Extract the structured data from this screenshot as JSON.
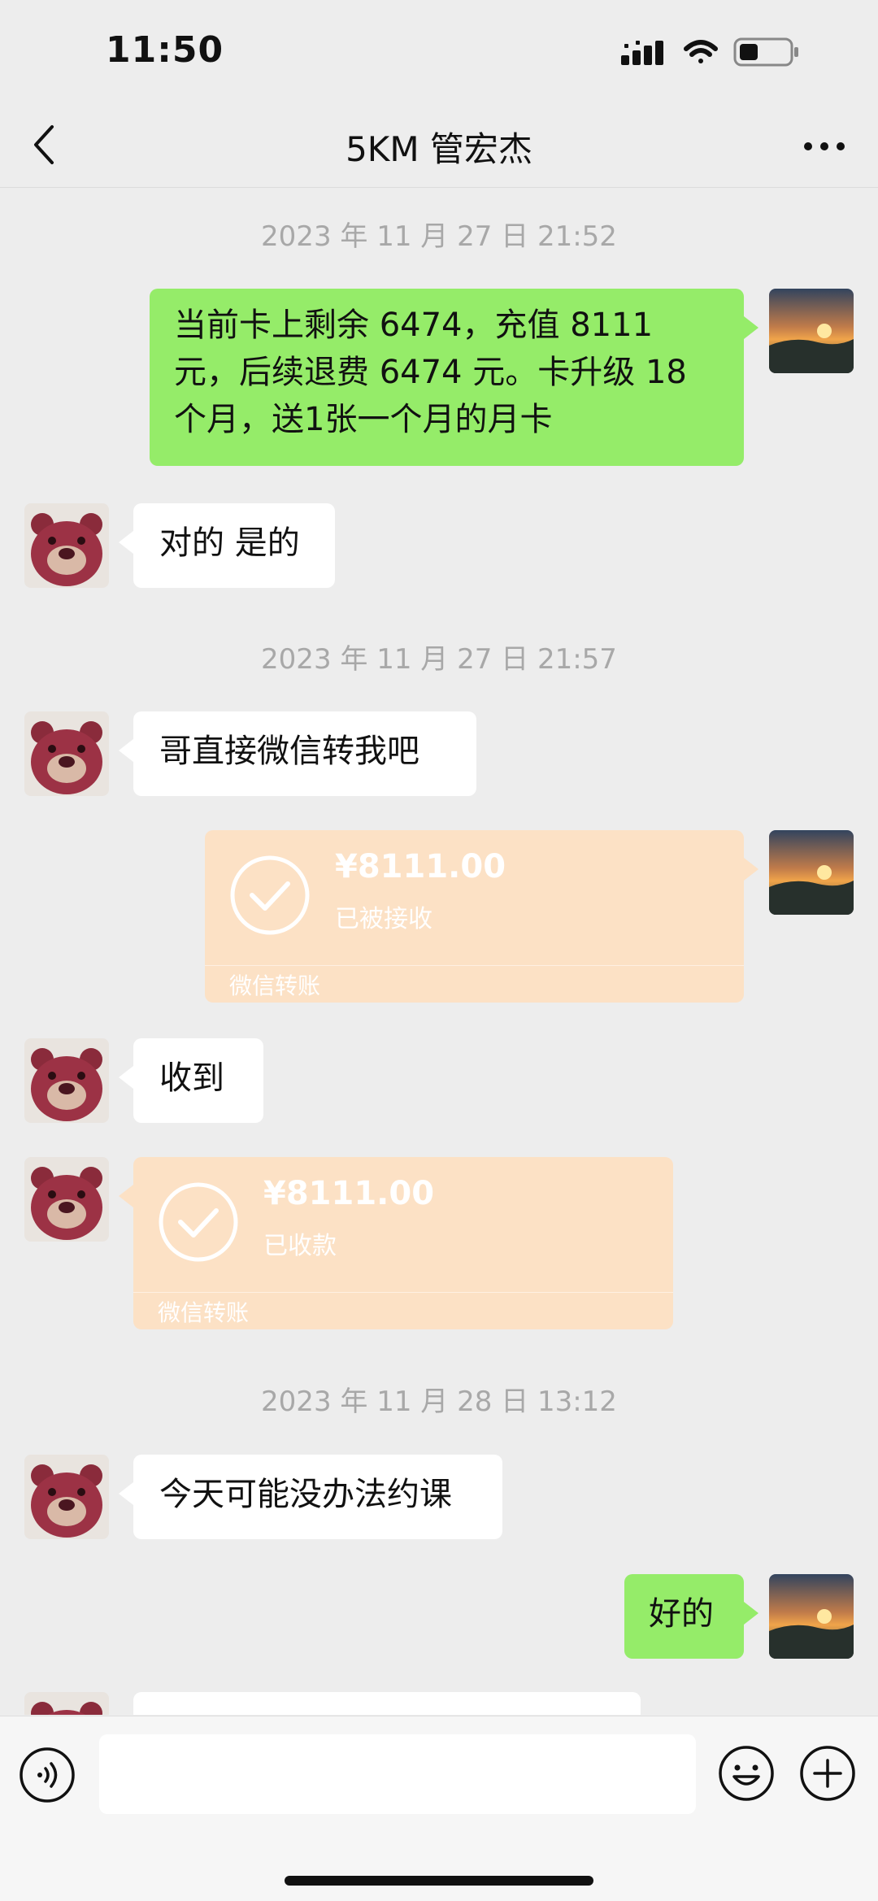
{
  "status_bar": {
    "time": "11:50"
  },
  "header": {
    "back_icon": "chevron-left-icon",
    "title": "5KM 管宏杰",
    "more_icon": "more-horizontal-icon"
  },
  "messages": {
    "ts1": "2023 年 11 月 27 日  21:52",
    "m1": "当前卡上剩余 6474，充值 8111 元，后续退费 6474 元。卡升级 18 个月，送1张一个月的月卡",
    "m2": "对的 是的",
    "ts2": "2023 年 11 月 27 日  21:57",
    "m3": "哥直接微信转我吧",
    "transfer1": {
      "amount": "¥8111.00",
      "status": "已被接收",
      "label": "微信转账"
    },
    "m4": "收到",
    "transfer2": {
      "amount": "¥8111.00",
      "status": "已收款",
      "label": "微信转账"
    },
    "ts3": "2023 年 11 月 28 日  13:12",
    "m5": "今天可能没办法约课",
    "m6": "好的"
  },
  "input_bar": {
    "voice_icon": "voice-icon",
    "emoji_icon": "emoji-icon",
    "plus_icon": "plus-circle-icon"
  },
  "colors": {
    "sent_bubble": "#95EC69",
    "received_bubble": "#FFFFFF",
    "transfer_card": "#FCE1C5",
    "background": "#EDEDED"
  }
}
